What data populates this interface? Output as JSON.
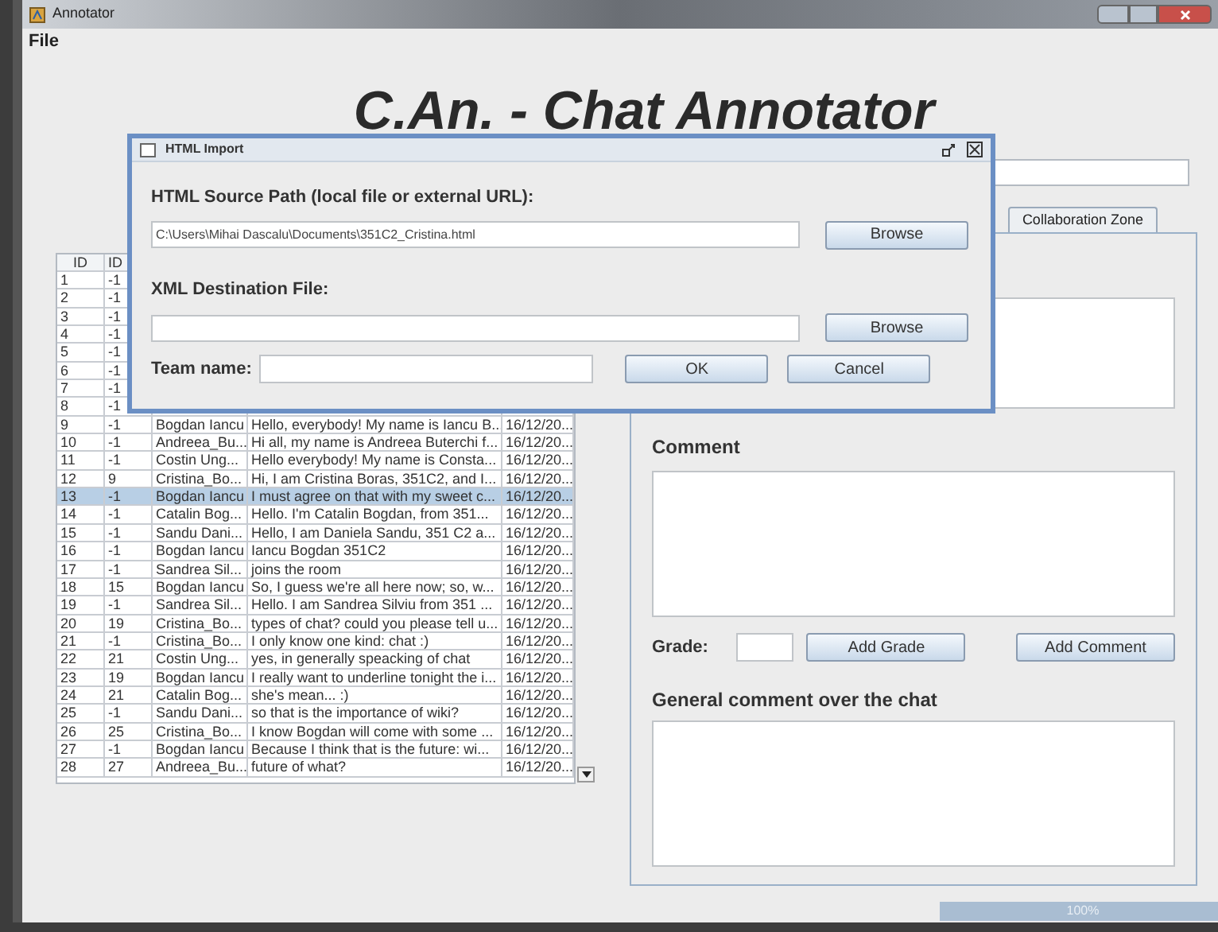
{
  "window": {
    "title": "Annotator"
  },
  "menu": [
    "File"
  ],
  "heading": "C.An. - Chat Annotator",
  "table": {
    "columns": [
      "ID",
      "ID"
    ],
    "rows": [
      {
        "id": "1",
        "ref": "-1",
        "selected": false
      },
      {
        "id": "2",
        "ref": "-1",
        "selected": false
      },
      {
        "id": "3",
        "ref": "-1",
        "selected": false
      },
      {
        "id": "4",
        "ref": "-1",
        "selected": false
      },
      {
        "id": "5",
        "ref": "-1",
        "selected": false
      },
      {
        "id": "6",
        "ref": "-1",
        "selected": false
      },
      {
        "id": "7",
        "ref": "-1",
        "selected": false
      },
      {
        "id": "8",
        "ref": "-1",
        "selected": false
      },
      {
        "id": "9",
        "ref": "-1",
        "user": "Bogdan Iancu",
        "text": "Hello, everybody! My name is Iancu B...",
        "time": "16/12/20...",
        "selected": false
      },
      {
        "id": "10",
        "ref": "-1",
        "user": "Andreea_Bu...",
        "text": "Hi all, my name is Andreea Buterchi f...",
        "time": "16/12/20...",
        "selected": false
      },
      {
        "id": "11",
        "ref": "-1",
        "user": "Costin Ung...",
        "text": "Hello everybody! My name is Consta...",
        "time": "16/12/20...",
        "selected": false
      },
      {
        "id": "12",
        "ref": "9",
        "user": "Cristina_Bo...",
        "text": "Hi, I am Cristina Boras, 351C2, and I...",
        "time": "16/12/20...",
        "selected": false
      },
      {
        "id": "13",
        "ref": "-1",
        "user": "Bogdan Iancu",
        "text": "I must agree on that with my sweet c...",
        "time": "16/12/20...",
        "selected": true
      },
      {
        "id": "14",
        "ref": "-1",
        "user": "Catalin Bog...",
        "text": "Hello. I'm Catalin Bogdan, from 351...",
        "time": "16/12/20...",
        "selected": false
      },
      {
        "id": "15",
        "ref": "-1",
        "user": "Sandu Dani...",
        "text": "Hello, I am Daniela Sandu, 351 C2 a...",
        "time": "16/12/20...",
        "selected": false
      },
      {
        "id": "16",
        "ref": "-1",
        "user": "Bogdan Iancu",
        "text": "Iancu Bogdan 351C2",
        "time": "16/12/20...",
        "selected": false
      },
      {
        "id": "17",
        "ref": "-1",
        "user": "Sandrea Sil...",
        "text": "joins the room",
        "time": "16/12/20...",
        "selected": false
      },
      {
        "id": "18",
        "ref": "15",
        "user": "Bogdan Iancu",
        "text": "So, I guess we're all here now; so, w...",
        "time": "16/12/20...",
        "selected": false
      },
      {
        "id": "19",
        "ref": "-1",
        "user": "Sandrea Sil...",
        "text": "Hello. I am Sandrea Silviu from 351 ...",
        "time": "16/12/20...",
        "selected": false
      },
      {
        "id": "20",
        "ref": "19",
        "user": "Cristina_Bo...",
        "text": "types of chat? could you please tell u...",
        "time": "16/12/20...",
        "selected": false
      },
      {
        "id": "21",
        "ref": "-1",
        "user": "Cristina_Bo...",
        "text": "I only know one kind: chat :)",
        "time": "16/12/20...",
        "selected": false
      },
      {
        "id": "22",
        "ref": "21",
        "user": "Costin Ung...",
        "text": "yes, in generally speacking of chat",
        "time": "16/12/20...",
        "selected": false
      },
      {
        "id": "23",
        "ref": "19",
        "user": "Bogdan Iancu",
        "text": "I really want to underline tonight the i...",
        "time": "16/12/20...",
        "selected": false
      },
      {
        "id": "24",
        "ref": "21",
        "user": "Catalin Bog...",
        "text": "she's mean... :)",
        "time": "16/12/20...",
        "selected": false
      },
      {
        "id": "25",
        "ref": "-1",
        "user": "Sandu Dani...",
        "text": "so that is the importance of wiki?",
        "time": "16/12/20...",
        "selected": false
      },
      {
        "id": "26",
        "ref": "25",
        "user": "Cristina_Bo...",
        "text": "I know Bogdan will come with some ...",
        "time": "16/12/20...",
        "selected": false
      },
      {
        "id": "27",
        "ref": "-1",
        "user": "Bogdan Iancu",
        "text": "Because  I think  that is the future: wi...",
        "time": "16/12/20...",
        "selected": false
      },
      {
        "id": "28",
        "ref": "27",
        "user": "Andreea_Bu...",
        "text": "future of what?",
        "time": "16/12/20...",
        "selected": false
      }
    ]
  },
  "tabs": [
    {
      "label": "Collaboration Zone",
      "selected": false
    }
  ],
  "annotation_panel": {
    "comment_label": "Comment",
    "grade_label": "Grade:",
    "add_grade": "Add Grade",
    "add_comment": "Add Comment",
    "general_label": "General comment over the chat"
  },
  "progress": {
    "level": 1,
    "reading": "100%"
  },
  "dialog": {
    "title": "HTML Import",
    "source_label": "HTML Source Path (local file or external URL):",
    "source_value": "C:\\Users\\Mihai Dascalu\\Documents\\351C2_Cristina.html",
    "browse_1": "Browse",
    "dest_label": "XML Destination File:",
    "browse_2": "Browse",
    "team_label": "Team name:",
    "ok": "OK",
    "cancel": "Cancel"
  }
}
